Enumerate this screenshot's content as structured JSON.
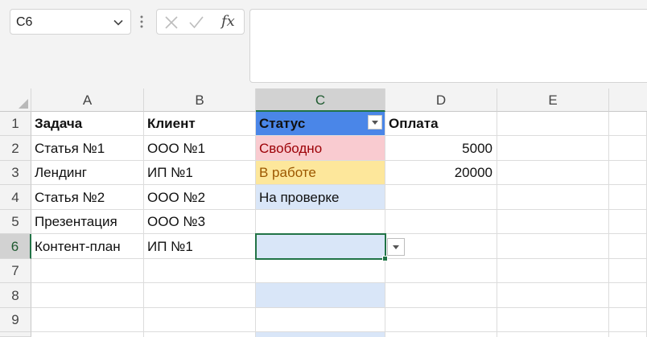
{
  "name_box": {
    "value": "C6"
  },
  "formula_bar": {
    "fx_label": "fx",
    "value": ""
  },
  "columns": [
    "A",
    "B",
    "C",
    "D",
    "E"
  ],
  "rows": [
    "1",
    "2",
    "3",
    "4",
    "5",
    "6",
    "7",
    "8",
    "9",
    ""
  ],
  "headers": {
    "task": "Задача",
    "client": "Клиент",
    "status": "Статус",
    "payment": "Оплата"
  },
  "data_rows": [
    {
      "task": "Статья №1",
      "client": "ООО №1",
      "status": "Свободно",
      "payment": "5000"
    },
    {
      "task": "Лендинг",
      "client": "ИП №1",
      "status": "В работе",
      "payment": "20000"
    },
    {
      "task": "Статья №2",
      "client": "ООО №2",
      "status": "На проверке",
      "payment": ""
    },
    {
      "task": "Презентация",
      "client": "ООО №3",
      "status": "",
      "payment": ""
    },
    {
      "task": "Контент-план",
      "client": "ИП №1",
      "status": "",
      "payment": ""
    }
  ],
  "colors": {
    "header_status_fill": "#4a86e8",
    "status_free_fill": "#f9cbd0",
    "status_free_text": "#9c0006",
    "status_work_fill": "#fde79b",
    "status_work_text": "#9c5700",
    "status_list_fill": "#d9e6f8",
    "selection_accent": "#217346"
  },
  "selected_cell": "C6"
}
